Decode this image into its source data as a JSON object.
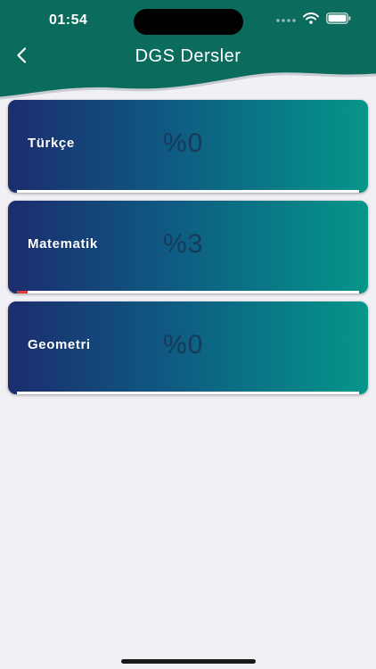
{
  "status_bar": {
    "time": "01:54"
  },
  "header": {
    "title": "DGS Dersler",
    "back_icon": "chevron-left-icon",
    "color": "#0b6b5c"
  },
  "courses": [
    {
      "name": "Türkçe",
      "percent_label": "%0",
      "progress": 0
    },
    {
      "name": "Matematik",
      "percent_label": "%3",
      "progress": 0.03
    },
    {
      "name": "Geometri",
      "percent_label": "%0",
      "progress": 0
    }
  ],
  "colors": {
    "gradient_start": "#1b2d6e",
    "gradient_end": "#05968a",
    "progress_fill": "#e03b3b",
    "background": "#f1f0f5"
  }
}
